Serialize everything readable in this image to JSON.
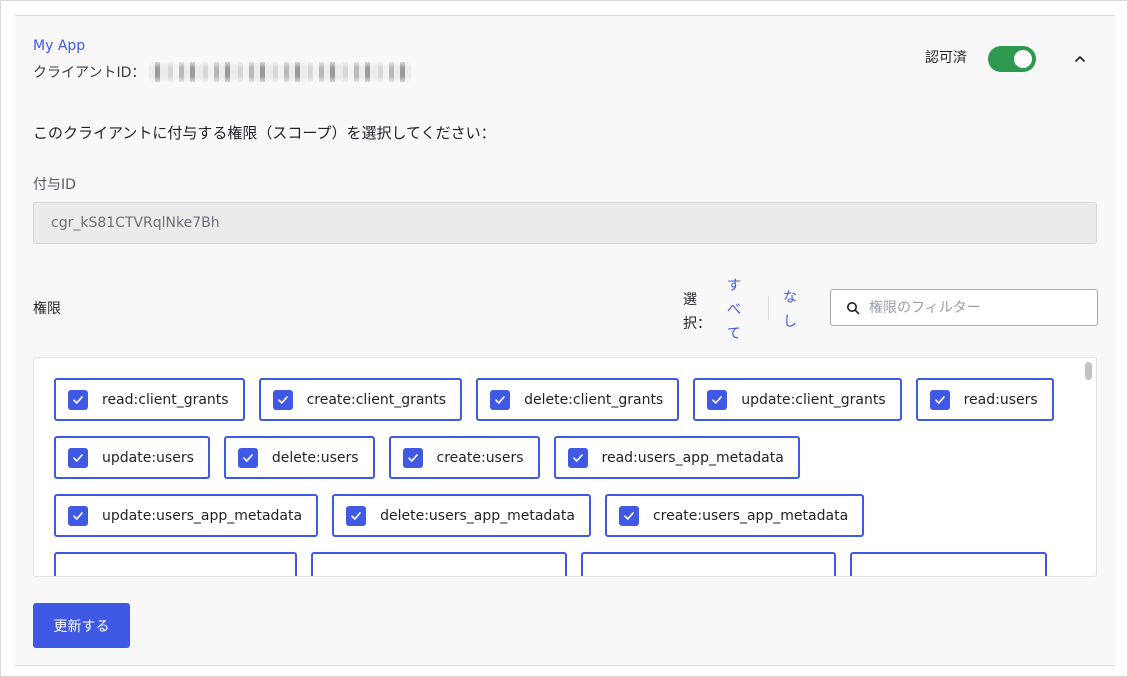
{
  "app": {
    "name": "My App",
    "client_id_label": "クライアントID：",
    "status_label": "認可済",
    "authorized": true
  },
  "instruction": "このクライアントに付与する権限（スコープ）を選択してください：",
  "grant": {
    "label": "付与ID",
    "value": "cgr_kS81CTVRqlNke7Bh"
  },
  "permissions": {
    "label": "権限",
    "select_label": "選択：",
    "select_all": "すべて",
    "select_none": "なし",
    "filter_placeholder": "権限のフィルター",
    "scopes": [
      {
        "label": "read:client_grants",
        "checked": true
      },
      {
        "label": "create:client_grants",
        "checked": true
      },
      {
        "label": "delete:client_grants",
        "checked": true
      },
      {
        "label": "update:client_grants",
        "checked": true
      },
      {
        "label": "read:users",
        "checked": true
      },
      {
        "label": "update:users",
        "checked": true
      },
      {
        "label": "delete:users",
        "checked": true
      },
      {
        "label": "create:users",
        "checked": true
      },
      {
        "label": "read:users_app_metadata",
        "checked": true
      },
      {
        "label": "update:users_app_metadata",
        "checked": true
      },
      {
        "label": "delete:users_app_metadata",
        "checked": true
      },
      {
        "label": "create:users_app_metadata",
        "checked": true
      }
    ]
  },
  "update_button": "更新する",
  "colors": {
    "accent": "#3f59e4",
    "toggle_on": "#2e9a4f"
  },
  "icons": {
    "collapse": "chevron-up-icon",
    "search": "search-icon",
    "check": "check-icon"
  }
}
